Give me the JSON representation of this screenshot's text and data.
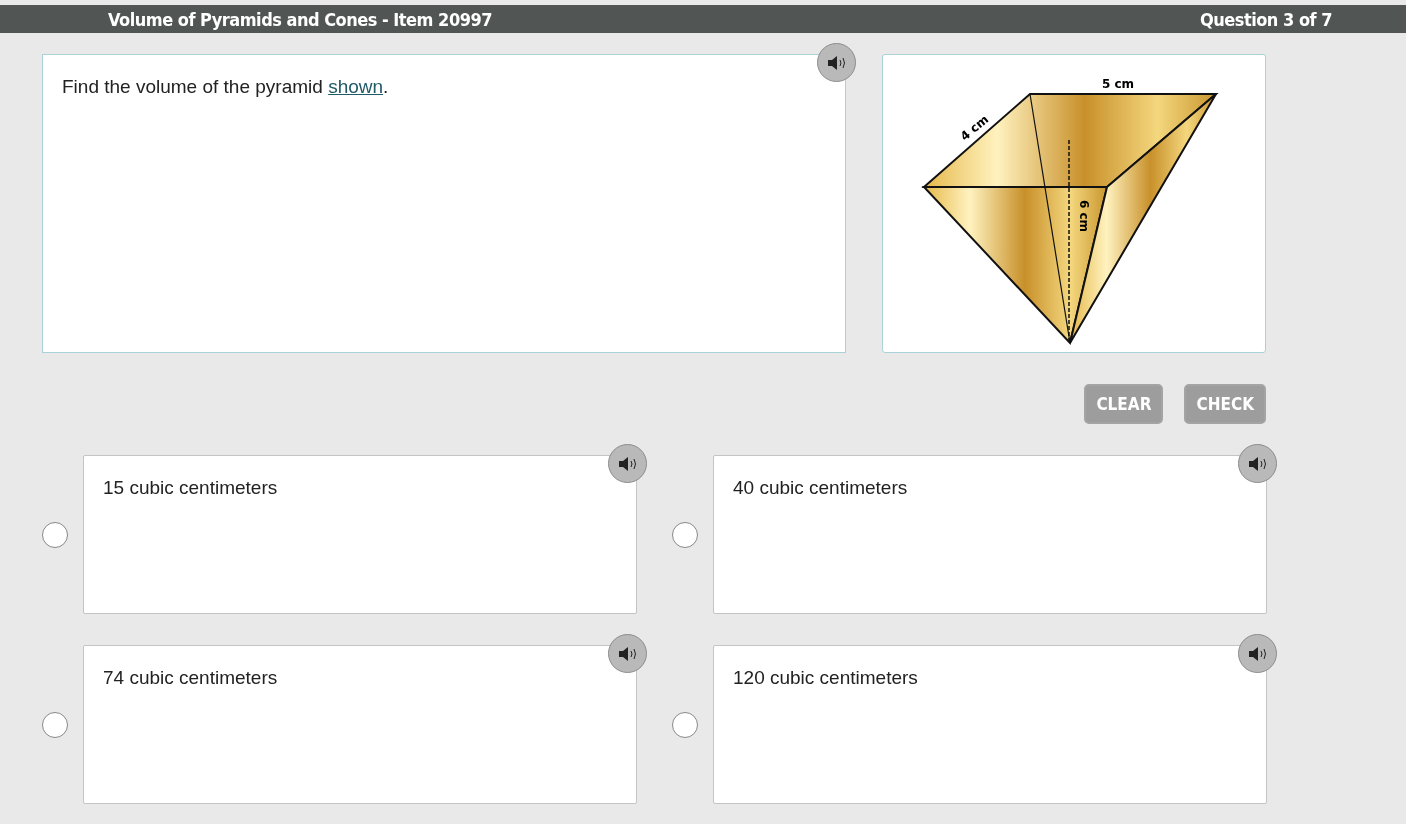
{
  "header": {
    "title": "Volume of Pyramids and Cones - Item 20997",
    "progress": "Question 3 of 7"
  },
  "question": {
    "text_before": "Find the volume of the pyramid ",
    "link": "shown",
    "text_after": "."
  },
  "figure": {
    "kind": "pyramid",
    "labels": {
      "length": "5 cm",
      "width": "4 cm",
      "height": "6 cm"
    }
  },
  "buttons": [
    {
      "label": "CLEAR",
      "disabled": true
    },
    {
      "label": "CHECK",
      "disabled": true
    }
  ],
  "choices": [
    {
      "text": "15 cubic centimeters",
      "selected": false
    },
    {
      "text": "40 cubic centimeters",
      "selected": false
    },
    {
      "text": "74 cubic centimeters",
      "selected": false
    },
    {
      "text": "120 cubic centimeters",
      "selected": false
    }
  ]
}
